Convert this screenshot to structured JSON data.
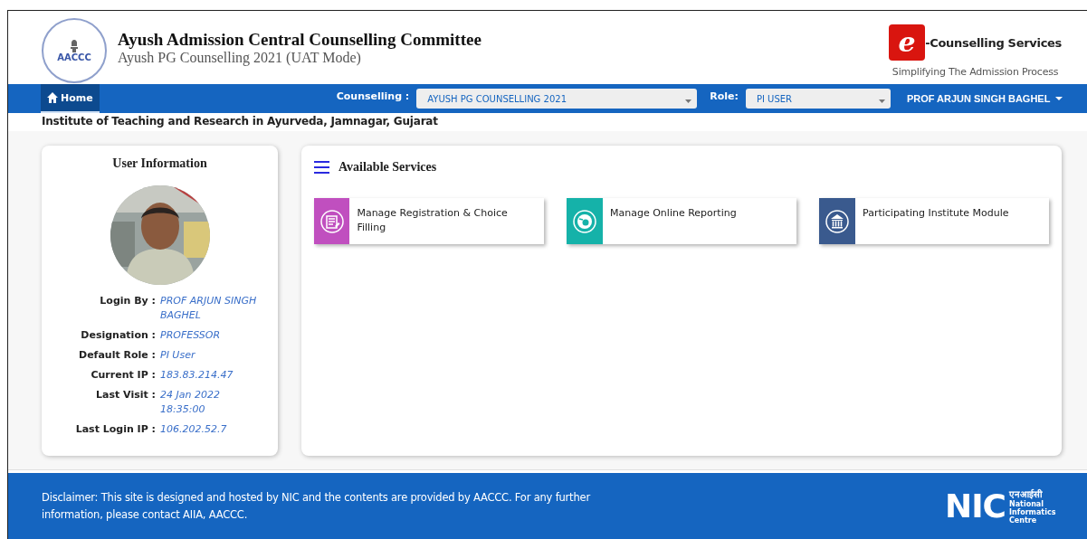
{
  "header": {
    "emblem_text": "AACCC",
    "title": "Ayush Admission Central Counselling Committee",
    "subtitle": "Ayush PG Counselling 2021 (UAT Mode)",
    "brand": {
      "letter": "e",
      "name": "-Counselling Services",
      "tagline": "Simplifying The Admission Process"
    }
  },
  "nav": {
    "home": {
      "label": "Home",
      "selected": true
    },
    "counselling": {
      "label": "Counselling :",
      "value": "AYUSH PG COUNSELLING 2021"
    },
    "role": {
      "label": "Role:",
      "value": "PI USER"
    },
    "user_menu": "PROF ARJUN SINGH BAGHEL"
  },
  "institute": "Institute of Teaching and Research in Ayurveda, Jamnagar, Gujarat",
  "user_info": {
    "title": "User Information",
    "fields": [
      {
        "label": "Login By :",
        "value": "PROF ARJUN SINGH BAGHEL"
      },
      {
        "label": "Designation :",
        "value": "PROFESSOR"
      },
      {
        "label": "Default Role :",
        "value": "PI User"
      },
      {
        "label": "Current IP :",
        "value": "183.83.214.47"
      },
      {
        "label": "Last Visit :",
        "value": "24 Jan 2022 18:35:00"
      },
      {
        "label": "Last Login IP :",
        "value": "106.202.52.7"
      }
    ]
  },
  "services": {
    "title": "Available Services",
    "items": [
      {
        "label": "Manage Registration & Choice Filling",
        "kind": "form",
        "color": "#c04fbf"
      },
      {
        "label": "Manage Online Reporting",
        "kind": "disc",
        "color": "#15b2a9"
      },
      {
        "label": "Participating Institute Module",
        "kind": "institution",
        "color": "#3a5a8e"
      }
    ]
  },
  "footer": {
    "disclaimer": "Disclaimer: This site is designed and hosted by NIC and the contents are provided by AACCC. For any further information, please contact AIIA, AACCC.",
    "nic": {
      "mark": "NIC",
      "hindi": "एनआईसी",
      "name": "National Informatics Centre"
    }
  }
}
